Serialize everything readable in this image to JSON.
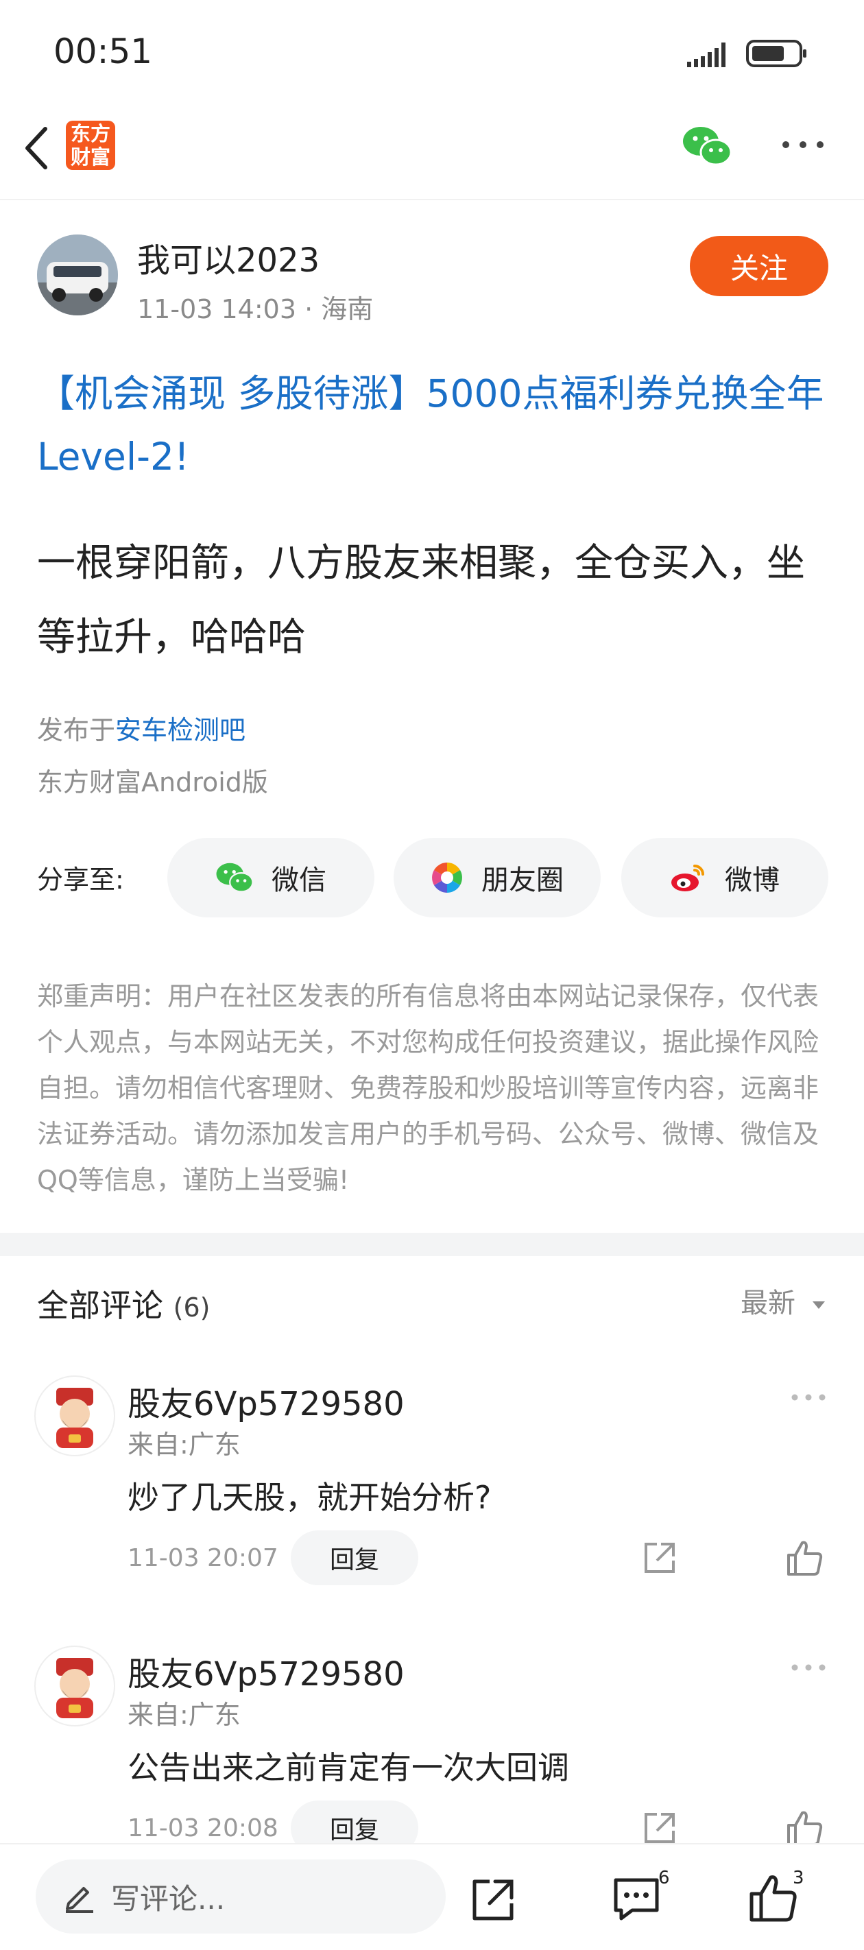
{
  "status_bar": {
    "time": "00:51"
  },
  "app": {
    "logo_text_line1": "东方",
    "logo_text_line2": "财富"
  },
  "author": {
    "name": "我可以2023",
    "date": "11-03 14:03",
    "location": "海南",
    "follow_label": "关注"
  },
  "post": {
    "title": "【机会涌现 多股待涨】5000点福利券兑换全年Level-2!",
    "body": "一根穿阳箭，八方股友来相聚，全仓买入，坐等拉升，哈哈哈",
    "published_prefix": "发布于",
    "bar_name": "安车检测吧",
    "client": "东方财富Android版"
  },
  "share": {
    "label": "分享至:",
    "wechat": "微信",
    "moments": "朋友圈",
    "weibo": "微博"
  },
  "disclaimer": "郑重声明：用户在社区发表的所有信息将由本网站记录保存，仅代表个人观点，与本网站无关，不对您构成任何投资建议，据此操作风险自担。请勿相信代客理财、免费荐股和炒股培训等宣传内容，远离非法证券活动。请勿添加发言用户的手机号码、公众号、微博、微信及QQ等信息，谨防上当受骗!",
  "comments_section": {
    "title": "全部评论",
    "count": "(6)",
    "sort_label": "最新"
  },
  "comments": [
    {
      "user": "股友6Vp5729580",
      "location": "来自:广东",
      "text": "炒了几天股，就开始分析?",
      "time": "11-03 20:07",
      "reply_label": "回复"
    },
    {
      "user": "股友6Vp5729580",
      "location": "来自:广东",
      "text": "公告出来之前肯定有一次大回调",
      "time": "11-03 20:08",
      "reply_label": "回复"
    }
  ],
  "bottom_bar": {
    "input_placeholder": "写评论...",
    "comment_count": "6",
    "like_count": "3"
  },
  "colors": {
    "accent": "#f25a18",
    "link": "#1a6fc7"
  }
}
